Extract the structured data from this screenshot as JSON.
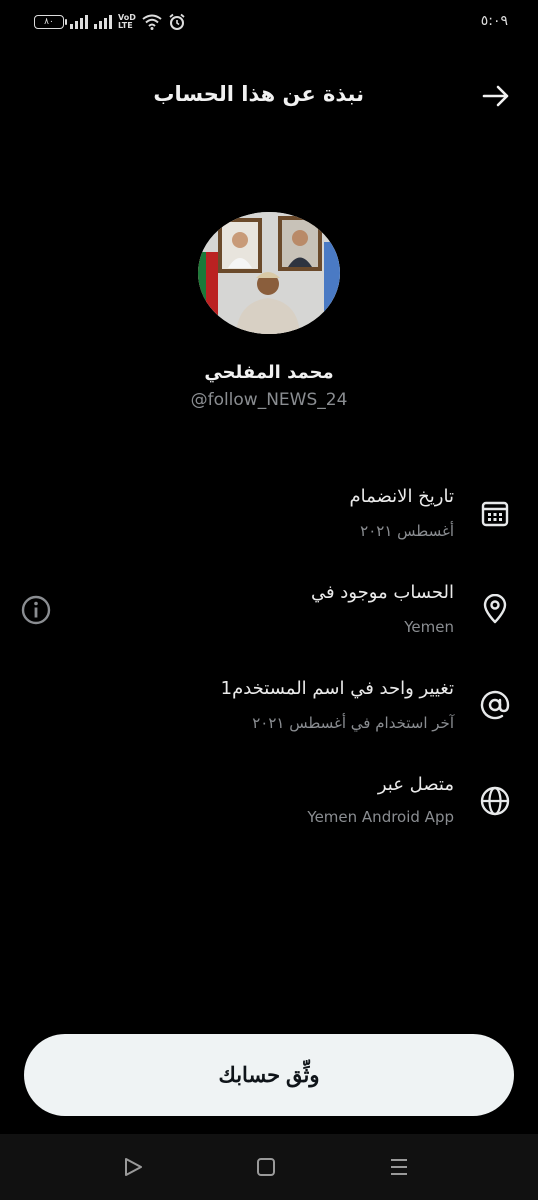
{
  "status_bar": {
    "battery": "٨٠",
    "network_tag_1": "VoD",
    "network_tag_2": "LTE",
    "time": "٥:٠٩"
  },
  "header": {
    "title": "نبذة عن هذا الحساب",
    "back_icon": "arrow-right-icon"
  },
  "profile": {
    "name": "محمد المفلحي",
    "handle": "@follow_NEWS_24"
  },
  "rows": [
    {
      "icon": "calendar-icon",
      "title": "تاريخ الانضمام",
      "subtitle": "أغسطس ٢٠٢١"
    },
    {
      "icon": "location-pin-icon",
      "title": "الحساب موجود في",
      "subtitle": "Yemen"
    },
    {
      "icon": "at-sign-icon",
      "title": "تغيير واحد في اسم المستخدم1",
      "subtitle": "آخر استخدام في أغسطس ٢٠٢١"
    },
    {
      "icon": "globe-icon",
      "title": "متصل عبر",
      "subtitle": "Yemen Android App"
    }
  ],
  "verify_button": {
    "label": "وثِّق حسابك"
  },
  "nav_bar": {
    "items": [
      "back-triangle-icon",
      "home-square-icon",
      "recents-menu-icon"
    ]
  },
  "colors": {
    "background": "#000000",
    "primary_text": "#e7e9ea",
    "secondary_text": "#8a8d91",
    "button_bg": "#eff3f4"
  }
}
